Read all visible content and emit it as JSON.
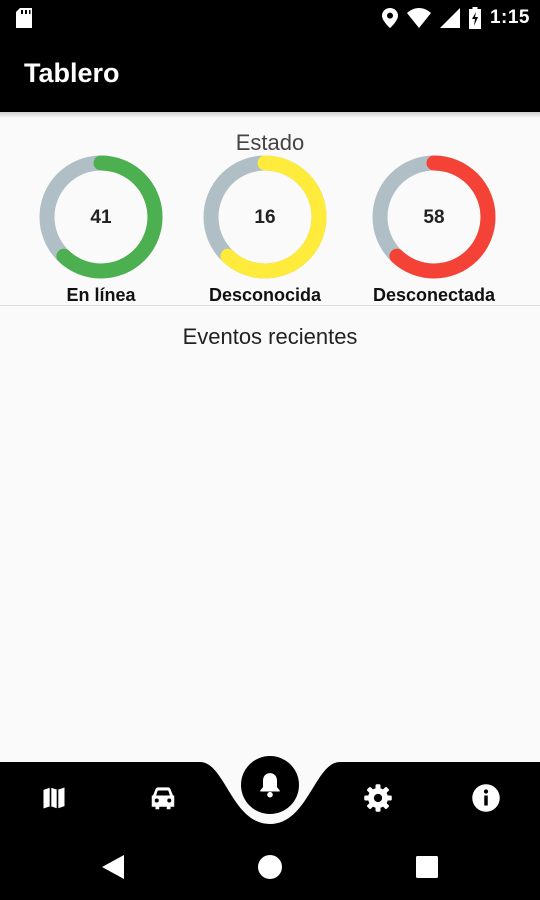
{
  "status_bar": {
    "time": "1:15",
    "icons": [
      "sd-card-icon",
      "location-pin-icon",
      "wifi-icon",
      "cell-signal-icon",
      "battery-charging-icon"
    ]
  },
  "app_bar": {
    "title": "Tablero"
  },
  "status_section": {
    "title": "Estado",
    "gauges": [
      {
        "value": "41",
        "label": "En línea",
        "color": "#4caf50",
        "fraction": 0.62
      },
      {
        "value": "16",
        "label": "Desconocida",
        "color": "#ffeb3b",
        "fraction": 0.62
      },
      {
        "value": "58",
        "label": "Desconectada",
        "color": "#f44336",
        "fraction": 0.62
      }
    ],
    "track_color": "#b0bec5"
  },
  "events_section": {
    "title": "Eventos recientes"
  },
  "bottom_nav": {
    "items": [
      "map-icon",
      "car-icon",
      "bell-icon",
      "gear-icon",
      "info-icon"
    ],
    "active": "bell-icon"
  },
  "system_nav": {
    "items": [
      "back-icon",
      "home-icon",
      "recents-icon"
    ]
  }
}
